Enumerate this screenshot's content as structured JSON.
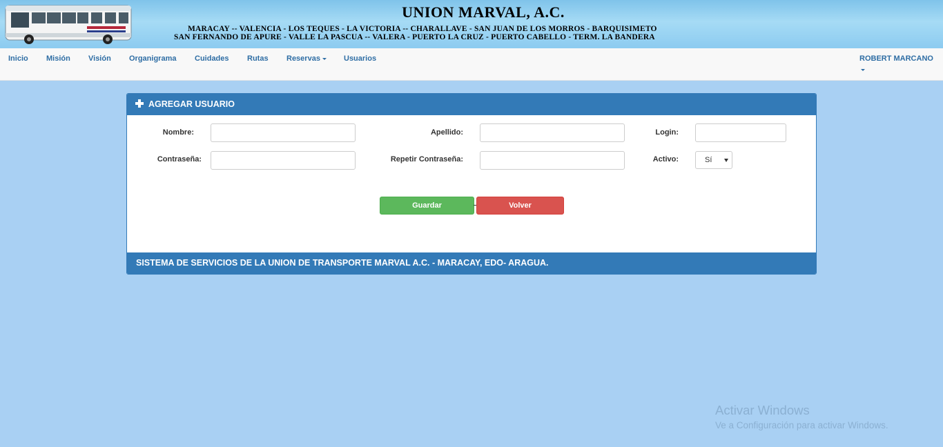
{
  "banner": {
    "title": "UNION MARVAL, A.C.",
    "route_line1": "MARACAY -- VALENCIA - LOS TEQUES - LA VICTORIA -- CHARALLAVE - SAN JUAN DE LOS MORROS - BARQUISIMETO",
    "route_line2": "SAN FERNANDO DE APURE - VALLE  LA PASCUA -- VALERA - PUERTO LA CRUZ - PUERTO CABELLO - TERM. LA BANDERA",
    "bus_image": "bus-photo"
  },
  "nav": {
    "items": [
      {
        "label": "Inicio"
      },
      {
        "label": "Misión"
      },
      {
        "label": "Visión"
      },
      {
        "label": "Organigrama"
      },
      {
        "label": "Cuidades"
      },
      {
        "label": "Rutas"
      },
      {
        "label": "Reservas",
        "dropdown": true
      },
      {
        "label": "Usuarios"
      }
    ],
    "user": "ROBERT MARCANO"
  },
  "panel": {
    "title": "AGREGAR USUARIO",
    "icon": "plus-icon",
    "fields": {
      "nombre": {
        "label": "Nombre:",
        "value": ""
      },
      "apellido": {
        "label": "Apellido:",
        "value": ""
      },
      "login": {
        "label": "Login:",
        "value": ""
      },
      "contrasena": {
        "label": "Contraseña:",
        "value": ""
      },
      "repetir": {
        "label": "Repetir Contraseña:",
        "value": ""
      },
      "activo": {
        "label": "Activo:",
        "selected": "Sí"
      }
    },
    "buttons": {
      "save": "Guardar",
      "back": "Volver"
    },
    "footer": "SISTEMA DE SERVICIOS DE LA UNION DE TRANSPORTE MARVAL A.C. - MARACAY, EDO- ARAGUA."
  },
  "watermark": {
    "title": "Activar Windows",
    "subtitle": "Ve a Configuración para activar Windows."
  },
  "colors": {
    "page_bg": "#a9d0f3",
    "primary": "#337ab7",
    "success": "#5cb85c",
    "danger": "#d9534f",
    "nav_link": "#2e6da4"
  }
}
